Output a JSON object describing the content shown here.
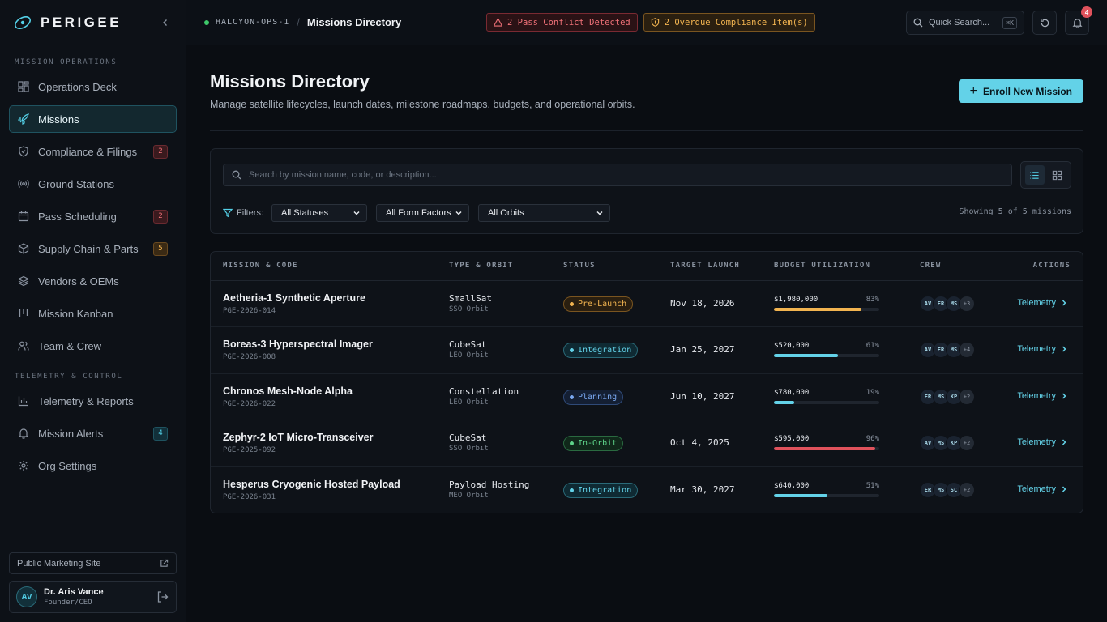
{
  "brand": {
    "name": "PERIGEE"
  },
  "sidebar": {
    "sections": [
      {
        "title": "MISSION OPERATIONS",
        "items": [
          {
            "label": "Operations Deck",
            "icon": "dashboard-icon",
            "badge": ""
          },
          {
            "label": "Missions",
            "icon": "rocket-icon",
            "badge": "",
            "active": true
          },
          {
            "label": "Compliance & Filings",
            "icon": "shield-icon",
            "badge": "2",
            "badge_color": "red"
          },
          {
            "label": "Ground Stations",
            "icon": "broadcast-icon",
            "badge": ""
          },
          {
            "label": "Pass Scheduling",
            "icon": "calendar-icon",
            "badge": "2",
            "badge_color": "red"
          },
          {
            "label": "Supply Chain & Parts",
            "icon": "package-icon",
            "badge": "5",
            "badge_color": "amber"
          },
          {
            "label": "Vendors & OEMs",
            "icon": "layers-icon",
            "badge": ""
          },
          {
            "label": "Mission Kanban",
            "icon": "kanban-icon",
            "badge": ""
          },
          {
            "label": "Team & Crew",
            "icon": "users-icon",
            "badge": ""
          }
        ]
      },
      {
        "title": "TELEMETRY & CONTROL",
        "items": [
          {
            "label": "Telemetry & Reports",
            "icon": "bar-chart-icon",
            "badge": ""
          },
          {
            "label": "Mission Alerts",
            "icon": "bell-icon",
            "badge": "4",
            "badge_color": "cyan"
          },
          {
            "label": "Org Settings",
            "icon": "gear-icon",
            "badge": ""
          }
        ]
      }
    ],
    "footer": {
      "marketing_label": "Public Marketing Site",
      "user": {
        "initials": "AV",
        "name": "Dr. Aris Vance",
        "role": "Founder/CEO"
      }
    }
  },
  "topbar": {
    "org": "HALCYON-OPS-1",
    "separator": "/",
    "page": "Missions Directory",
    "alerts": [
      {
        "label": "2 Pass Conflict Detected",
        "color": "red",
        "icon": "warning-triangle-icon"
      },
      {
        "label": "2 Overdue Compliance Item(s)",
        "color": "amber",
        "icon": "shield-alert-icon"
      }
    ],
    "search": {
      "label": "Quick Search...",
      "shortcut": "⌘K"
    },
    "notifications": {
      "count": "4"
    }
  },
  "page": {
    "title": "Missions Directory",
    "subtitle": "Manage satellite lifecycles, launch dates, milestone roadmaps, budgets, and operational orbits.",
    "enroll_label": "Enroll New Mission"
  },
  "filters": {
    "search_placeholder": "Search by mission name, code, or description...",
    "label": "Filters:",
    "status": "All Statuses",
    "form_factor": "All Form Factors",
    "orbit": "All Orbits",
    "showing": "Showing 5 of 5 missions"
  },
  "table": {
    "headers": {
      "mission": "MISSION & CODE",
      "type": "TYPE & ORBIT",
      "status": "STATUS",
      "launch": "TARGET LAUNCH",
      "budget": "BUDGET UTILIZATION",
      "crew": "CREW",
      "actions": "ACTIONS"
    },
    "action_label": "Telemetry",
    "rows": [
      {
        "name": "Aetheria-1 Synthetic Aperture",
        "code": "PGE-2026-014",
        "type": "SmallSat",
        "orbit": "SSO Orbit",
        "status": "Pre-Launch",
        "status_key": "prelaunch",
        "launch": "Nov 18, 2026",
        "budget": "$1,980,000",
        "pct_label": "83%",
        "pct": 83,
        "bar_color": "#f2b450",
        "crew": [
          "AV",
          "ER",
          "MS"
        ],
        "crew_more": "+3"
      },
      {
        "name": "Boreas-3 Hyperspectral Imager",
        "code": "PGE-2026-008",
        "type": "CubeSat",
        "orbit": "LEO Orbit",
        "status": "Integration",
        "status_key": "integration",
        "launch": "Jan 25, 2027",
        "budget": "$520,000",
        "pct_label": "61%",
        "pct": 61,
        "bar_color": "#63d2e8",
        "crew": [
          "AV",
          "ER",
          "MS"
        ],
        "crew_more": "+4"
      },
      {
        "name": "Chronos Mesh-Node Alpha",
        "code": "PGE-2026-022",
        "type": "Constellation",
        "orbit": "LEO Orbit",
        "status": "Planning",
        "status_key": "planning",
        "launch": "Jun 10, 2027",
        "budget": "$780,000",
        "pct_label": "19%",
        "pct": 19,
        "bar_color": "#63d2e8",
        "crew": [
          "ER",
          "MS",
          "KP"
        ],
        "crew_more": "+2"
      },
      {
        "name": "Zephyr-2 IoT Micro-Transceiver",
        "code": "PGE-2025-092",
        "type": "CubeSat",
        "orbit": "SSO Orbit",
        "status": "In-Orbit",
        "status_key": "inorbit",
        "launch": "Oct 4, 2025",
        "budget": "$595,000",
        "pct_label": "96%",
        "pct": 96,
        "bar_color": "#e0525c",
        "crew": [
          "AV",
          "MS",
          "KP"
        ],
        "crew_more": "+2"
      },
      {
        "name": "Hesperus Cryogenic Hosted Payload",
        "code": "PGE-2026-031",
        "type": "Payload Hosting",
        "orbit": "MEO Orbit",
        "status": "Integration",
        "status_key": "integration",
        "launch": "Mar 30, 2027",
        "budget": "$640,000",
        "pct_label": "51%",
        "pct": 51,
        "bar_color": "#63d2e8",
        "crew": [
          "ER",
          "MS",
          "SC"
        ],
        "crew_more": "+2"
      }
    ]
  }
}
